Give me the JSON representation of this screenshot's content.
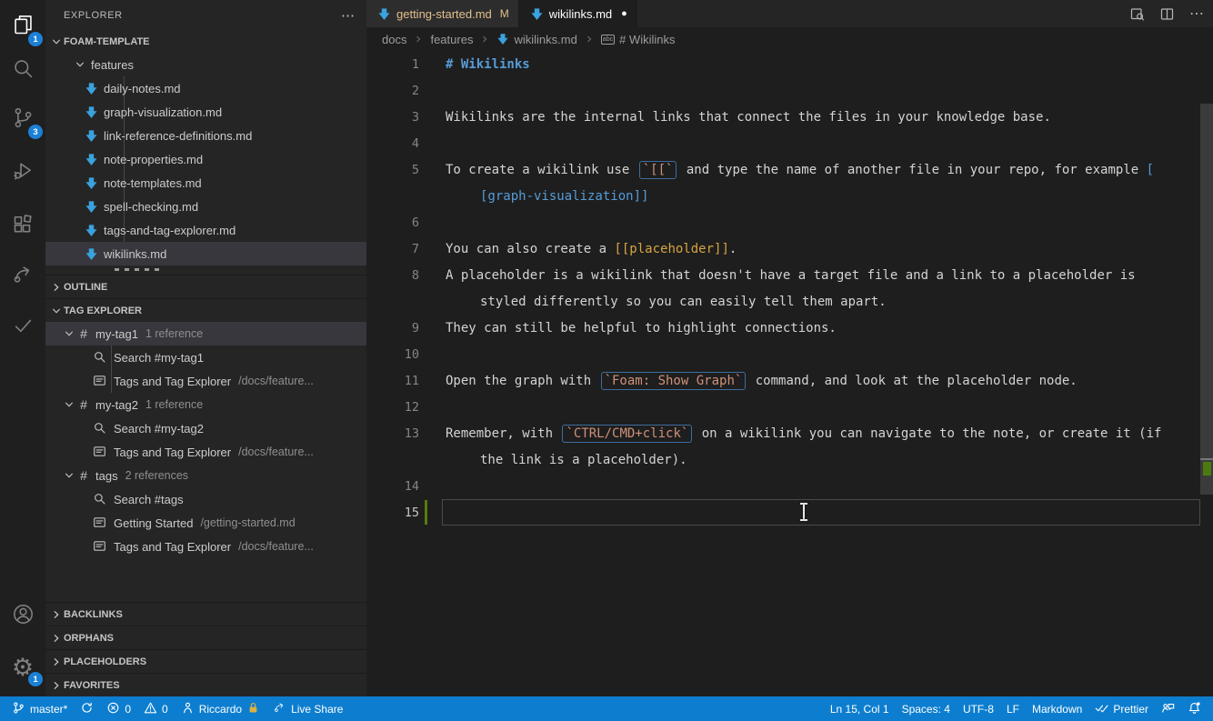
{
  "app": {
    "accent": "#0d7ecf",
    "editor_bg": "#1e1e1e",
    "sidebar_bg": "#252526",
    "activitybar_bg": "#1f1f20"
  },
  "activity_bar": {
    "top": [
      {
        "id": "explorer",
        "icon": "files-icon",
        "badge": "1",
        "active": true
      },
      {
        "id": "search",
        "icon": "search-icon"
      },
      {
        "id": "source-control",
        "icon": "source-control-icon",
        "badge": "3"
      },
      {
        "id": "run-debug",
        "icon": "debug-icon"
      },
      {
        "id": "extensions",
        "icon": "extensions-icon"
      },
      {
        "id": "live-share",
        "icon": "live-share-icon"
      },
      {
        "id": "checks",
        "icon": "check-icon"
      }
    ],
    "bottom": [
      {
        "id": "account",
        "icon": "account-icon"
      },
      {
        "id": "settings",
        "icon": "gear-icon",
        "badge": "1"
      }
    ]
  },
  "sidebar": {
    "title": "EXPLORER",
    "explorer_section": {
      "label": "FOAM-TEMPLATE",
      "folder_label": "features",
      "files": [
        "daily-notes.md",
        "graph-visualization.md",
        "link-reference-definitions.md",
        "note-properties.md",
        "note-templates.md",
        "spell-checking.md",
        "tags-and-tag-explorer.md",
        "wikilinks.md"
      ],
      "selected_file": "wikilinks.md"
    },
    "outline_label": "OUTLINE",
    "tag_section": {
      "label": "TAG EXPLORER",
      "tags": [
        {
          "label": "my-tag1",
          "count_label": "1 reference",
          "selected": true,
          "children": [
            {
              "kind": "search",
              "label": "Search #my-tag1"
            },
            {
              "kind": "note",
              "label": "Tags and Tag Explorer",
              "path": "/docs/feature..."
            }
          ]
        },
        {
          "label": "my-tag2",
          "count_label": "1 reference",
          "children": [
            {
              "kind": "search",
              "label": "Search #my-tag2"
            },
            {
              "kind": "note",
              "label": "Tags and Tag Explorer",
              "path": "/docs/feature..."
            }
          ]
        },
        {
          "label": "tags",
          "count_label": "2 references",
          "children": [
            {
              "kind": "search",
              "label": "Search #tags"
            },
            {
              "kind": "note",
              "label": "Getting Started",
              "path": "/getting-started.md"
            },
            {
              "kind": "note",
              "label": "Tags and Tag Explorer",
              "path": "/docs/feature..."
            }
          ]
        }
      ]
    },
    "bottom_sections": [
      {
        "label": "BACKLINKS"
      },
      {
        "label": "ORPHANS"
      },
      {
        "label": "PLACEHOLDERS"
      },
      {
        "label": "FAVORITES"
      }
    ]
  },
  "editor": {
    "tabs": [
      {
        "label": "getting-started.md",
        "badge": "M",
        "state": "modified",
        "active": false
      },
      {
        "label": "wikilinks.md",
        "dirty": true,
        "state": "normal",
        "active": true
      }
    ],
    "breadcrumbs": [
      {
        "label": "docs"
      },
      {
        "label": "features"
      },
      {
        "label": "wikilinks.md",
        "icon": "md-file-icon"
      },
      {
        "label": "# Wikilinks",
        "icon": "symbol-text-icon"
      }
    ],
    "colors": {
      "heading": "#569cd6",
      "link": "#559cd9",
      "placeholder": "#d7a442",
      "code": "#ce9178",
      "text": "#d4d4d4"
    },
    "rows": [
      {
        "n": "1",
        "segs": [
          {
            "t": "# Wikilinks",
            "s": "h"
          }
        ]
      },
      {
        "n": "2",
        "segs": []
      },
      {
        "n": "3",
        "segs": [
          {
            "t": "Wikilinks are the internal links that connect the files in your knowledge base."
          }
        ]
      },
      {
        "n": "4",
        "segs": []
      },
      {
        "n": "5",
        "segs": [
          {
            "t": "To create a wikilink use "
          },
          {
            "t": "`[[`",
            "s": "code"
          },
          {
            "t": " and type the name of another file in your repo, for example "
          },
          {
            "t": "[",
            "s": "link"
          }
        ]
      },
      {
        "wrap": true,
        "segs": [
          {
            "t": "[graph-visualization]]",
            "s": "link"
          }
        ]
      },
      {
        "n": "6",
        "segs": []
      },
      {
        "n": "7",
        "segs": [
          {
            "t": "You can also create a "
          },
          {
            "t": "[[placeholder]]",
            "s": "ph"
          },
          {
            "t": "."
          }
        ]
      },
      {
        "n": "8",
        "segs": [
          {
            "t": "A placeholder is a wikilink that doesn't have a target file and a link to a placeholder is"
          }
        ]
      },
      {
        "wrap": true,
        "segs": [
          {
            "t": "styled differently so you can easily tell them apart."
          }
        ]
      },
      {
        "n": "9",
        "segs": [
          {
            "t": "They can still be helpful to highlight connections."
          }
        ]
      },
      {
        "n": "10",
        "segs": []
      },
      {
        "n": "11",
        "segs": [
          {
            "t": "Open the graph with "
          },
          {
            "t": "`Foam: Show Graph`",
            "s": "code"
          },
          {
            "t": " command, and look at the placeholder node."
          }
        ]
      },
      {
        "n": "12",
        "segs": []
      },
      {
        "n": "13",
        "segs": [
          {
            "t": "Remember, with "
          },
          {
            "t": "`CTRL/CMD+click`",
            "s": "code"
          },
          {
            "t": " on a wikilink you can navigate to the note, or create it (if"
          }
        ]
      },
      {
        "wrap": true,
        "segs": [
          {
            "t": "the link is a placeholder)."
          }
        ]
      },
      {
        "n": "14",
        "segs": []
      },
      {
        "n": "15",
        "segs": [],
        "current": true,
        "git": "added"
      }
    ]
  },
  "status_bar": {
    "left": [
      {
        "id": "branch",
        "icon": "git-branch-icon",
        "label": "master*"
      },
      {
        "id": "sync",
        "icon": "sync-icon",
        "label": ""
      },
      {
        "id": "errors",
        "icon": "error-icon",
        "label": "0"
      },
      {
        "id": "warnings",
        "icon": "warning-icon",
        "label": "0"
      },
      {
        "id": "account",
        "icon": "person-icon",
        "label": "Riccardo",
        "suffix_icon": "lock-icon"
      },
      {
        "id": "live-share",
        "icon": "live-share-icon",
        "label": "Live Share"
      }
    ],
    "right": [
      {
        "id": "cursor-position",
        "label": "Ln 15, Col 1"
      },
      {
        "id": "indentation",
        "label": "Spaces: 4"
      },
      {
        "id": "encoding",
        "label": "UTF-8"
      },
      {
        "id": "eol",
        "label": "LF"
      },
      {
        "id": "language-mode",
        "label": "Markdown"
      },
      {
        "id": "formatter",
        "icon": "double-check-icon",
        "label": "Prettier"
      },
      {
        "id": "feedback",
        "icon": "feedback-icon",
        "label": ""
      },
      {
        "id": "notifications",
        "icon": "bell-icon",
        "label": ""
      }
    ]
  }
}
